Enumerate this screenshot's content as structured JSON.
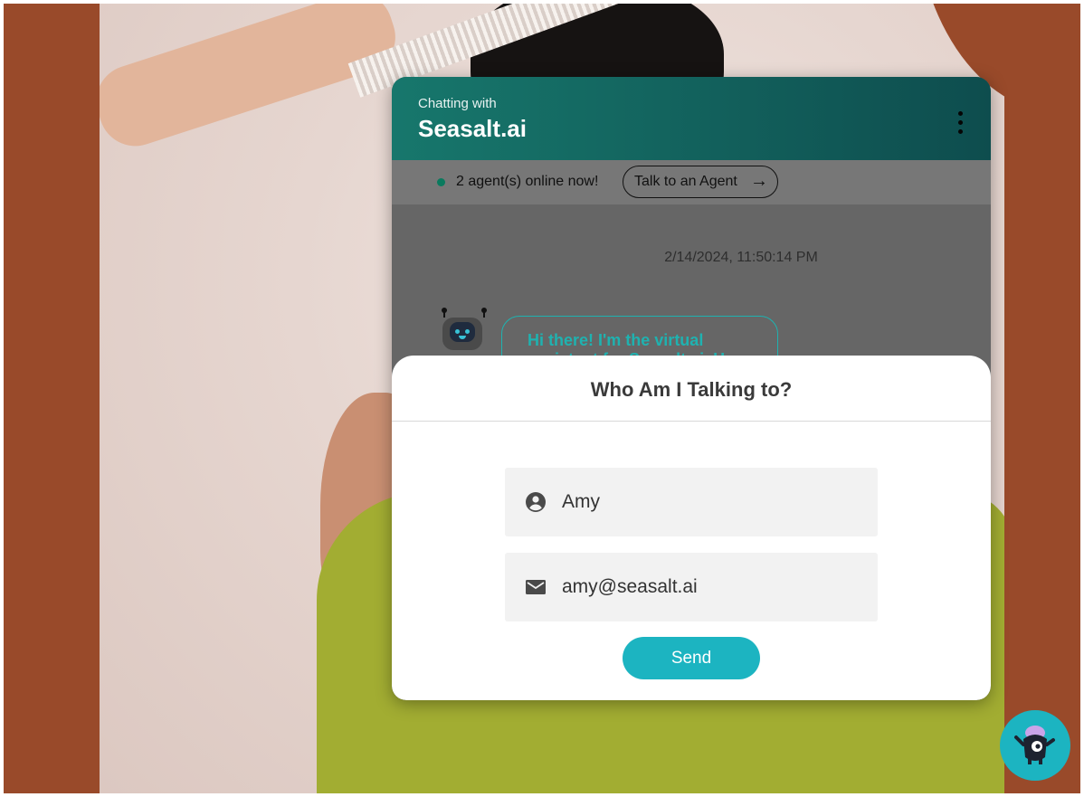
{
  "header": {
    "subtitle": "Chatting with",
    "title": "Seasalt.ai"
  },
  "status": {
    "online_text": "2 agent(s) online now!",
    "talk_button": "Talk to an Agent",
    "arrow": "→"
  },
  "conversation": {
    "timestamp": "2/14/2024, 11:50:14 PM",
    "greeting": "Hi there! I'm the virtual assistant for Seasalt.ai. How"
  },
  "dialog": {
    "title": "Who Am I Talking to?",
    "name_value": "Amy",
    "email_value": "amy@seasalt.ai",
    "send_label": "Send"
  },
  "icons": {
    "menu": "kebab-menu-icon",
    "name": "account-circle-icon",
    "email": "mail-icon",
    "bot": "robot-avatar-icon",
    "launcher": "monster-mascot-icon"
  },
  "colors": {
    "accent": "#1cb4c1",
    "header_start": "#17776c",
    "header_end": "#0e4d4e",
    "background": "#994a2a",
    "online_dot": "#0a7a5e"
  }
}
